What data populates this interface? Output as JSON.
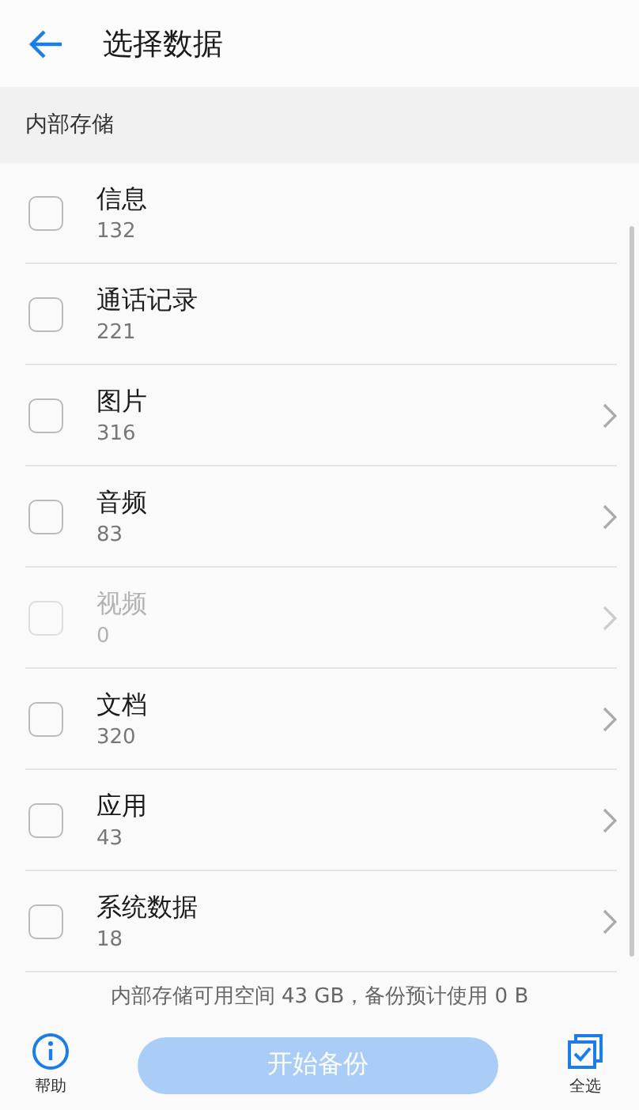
{
  "header": {
    "title": "选择数据"
  },
  "section": {
    "title": "内部存储"
  },
  "items": [
    {
      "name": "信息",
      "count": "132",
      "checked": false,
      "disabled": false,
      "has_chevron": false
    },
    {
      "name": "通话记录",
      "count": "221",
      "checked": false,
      "disabled": false,
      "has_chevron": false
    },
    {
      "name": "图片",
      "count": "316",
      "checked": false,
      "disabled": false,
      "has_chevron": true
    },
    {
      "name": "音频",
      "count": "83",
      "checked": false,
      "disabled": false,
      "has_chevron": true
    },
    {
      "name": "视频",
      "count": "0",
      "checked": false,
      "disabled": true,
      "has_chevron": true
    },
    {
      "name": "文档",
      "count": "320",
      "checked": false,
      "disabled": false,
      "has_chevron": true
    },
    {
      "name": "应用",
      "count": "43",
      "checked": false,
      "disabled": false,
      "has_chevron": true
    },
    {
      "name": "系统数据",
      "count": "18",
      "checked": false,
      "disabled": false,
      "has_chevron": true
    }
  ],
  "storage_note": "内部存储可用空间 43 GB，备份预计使用 0 B",
  "bottom_bar": {
    "help_label": "帮助",
    "start_button": {
      "label": "开始备份",
      "disabled": true
    },
    "select_all_label": "全选"
  }
}
